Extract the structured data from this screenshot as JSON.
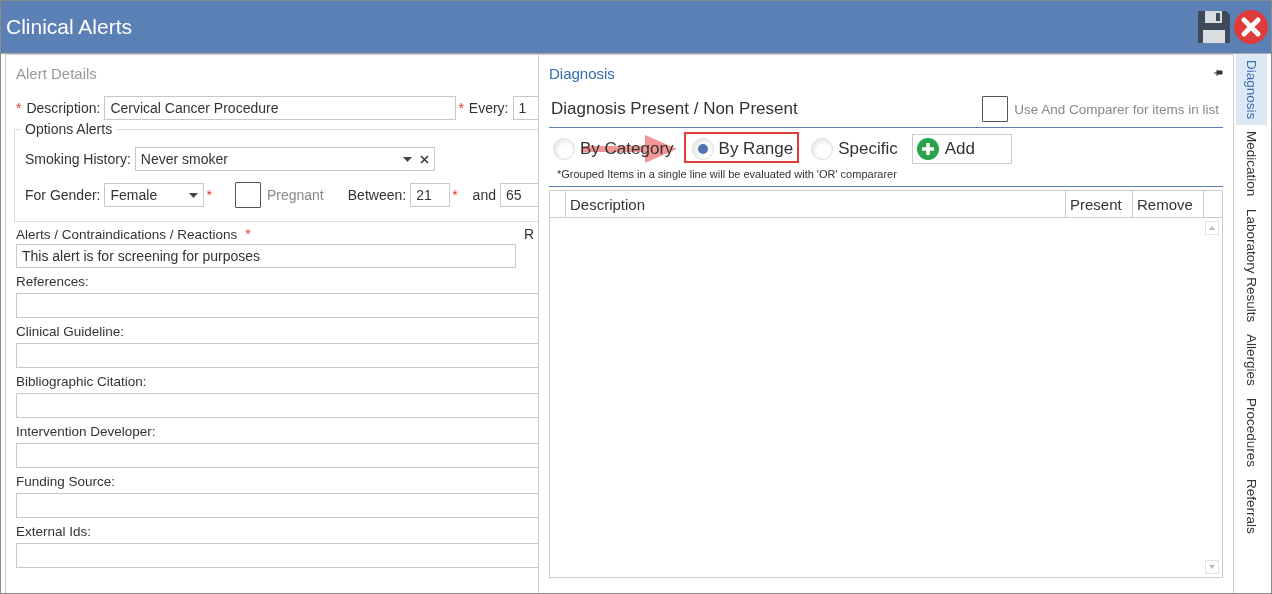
{
  "window": {
    "title": "Clinical Alerts"
  },
  "alert_details": {
    "title": "Alert Details",
    "description": {
      "label": "Description:",
      "value": "Cervical Cancer Procedure",
      "required_mark": "*"
    },
    "every": {
      "label": "Every:",
      "value": "1",
      "required_mark": "*"
    },
    "options_alerts": {
      "title": "Options Alerts",
      "smoking_history": {
        "label": "Smoking History:",
        "value": "Never smoker"
      },
      "gender": {
        "label": "For Gender:",
        "value": "Female",
        "required_mark": "*"
      },
      "pregnant": {
        "label": "Pregnant",
        "checked": false
      },
      "between": {
        "label": "Between:",
        "value": "21",
        "required_mark": "*"
      },
      "and": {
        "label": "and",
        "value": "65"
      }
    },
    "reactions": {
      "label": "Alerts / Contraindications / Reactions",
      "required_mark": "*",
      "value": "This alert is for screening for purposes"
    },
    "column_2_label": "R",
    "fields": [
      {
        "label": "References:"
      },
      {
        "label": "Clinical Guideline:"
      },
      {
        "label": "Bibliographic Citation:"
      },
      {
        "label": "Intervention Developer:"
      },
      {
        "label": "Funding Source:"
      },
      {
        "label": "External Ids:"
      }
    ]
  },
  "diagnosis": {
    "title": "Diagnosis",
    "heading": "Diagnosis Present / Non Present",
    "use_and": {
      "label": "Use And Comparer for items in list",
      "checked": false
    },
    "modes": [
      {
        "label": "By Category",
        "selected": false
      },
      {
        "label": "By Range",
        "selected": true
      },
      {
        "label": "Specific",
        "selected": false
      }
    ],
    "add_button": "Add",
    "note": "*Grouped Items in a single line will be evaluated with 'OR' compararer",
    "table": {
      "columns": [
        "Description",
        "Present",
        "Remove"
      ]
    }
  },
  "side_tabs": [
    {
      "label": "Diagnosis",
      "selected": true
    },
    {
      "label": "Medication",
      "selected": false
    },
    {
      "label": "Laboratory Results",
      "selected": false
    },
    {
      "label": "Allergies",
      "selected": false
    },
    {
      "label": "Procedures",
      "selected": false
    },
    {
      "label": "Referrals",
      "selected": false
    }
  ]
}
